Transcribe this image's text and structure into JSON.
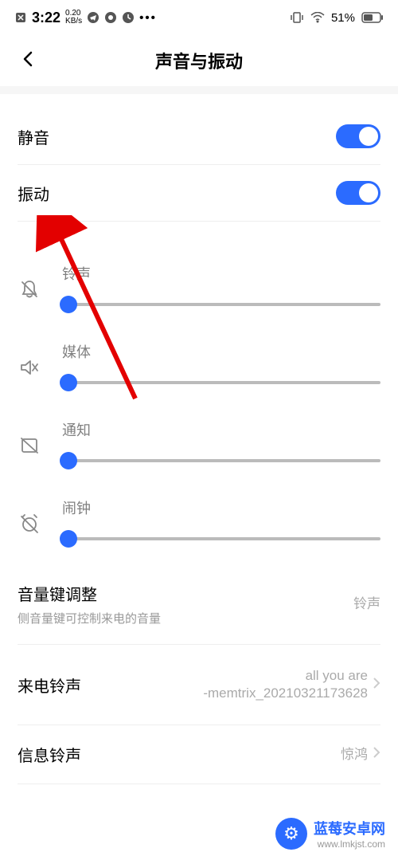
{
  "status": {
    "time": "3:22",
    "speed": "0.20",
    "speed_unit": "KB/s",
    "battery": "51%",
    "dots": "•••"
  },
  "header": {
    "title": "声音与振动"
  },
  "toggles": {
    "mute": {
      "label": "静音",
      "on": true
    },
    "vibrate": {
      "label": "振动",
      "on": true
    }
  },
  "sliders": {
    "ringtone": {
      "label": "铃声",
      "value": 2
    },
    "media": {
      "label": "媒体",
      "value": 2
    },
    "notification": {
      "label": "通知",
      "value": 2
    },
    "alarm": {
      "label": "闹钟",
      "value": 2
    }
  },
  "volume_key": {
    "title": "音量键调整",
    "sub": "侧音量键可控制来电的音量",
    "value": "铃声"
  },
  "incoming": {
    "title": "来电铃声",
    "value": "all you are\n-memtrix_20210321173628"
  },
  "message": {
    "title": "信息铃声",
    "value": "惊鸿"
  },
  "watermark": {
    "title": "蓝莓安卓网",
    "url": "www.lmkjst.com"
  }
}
